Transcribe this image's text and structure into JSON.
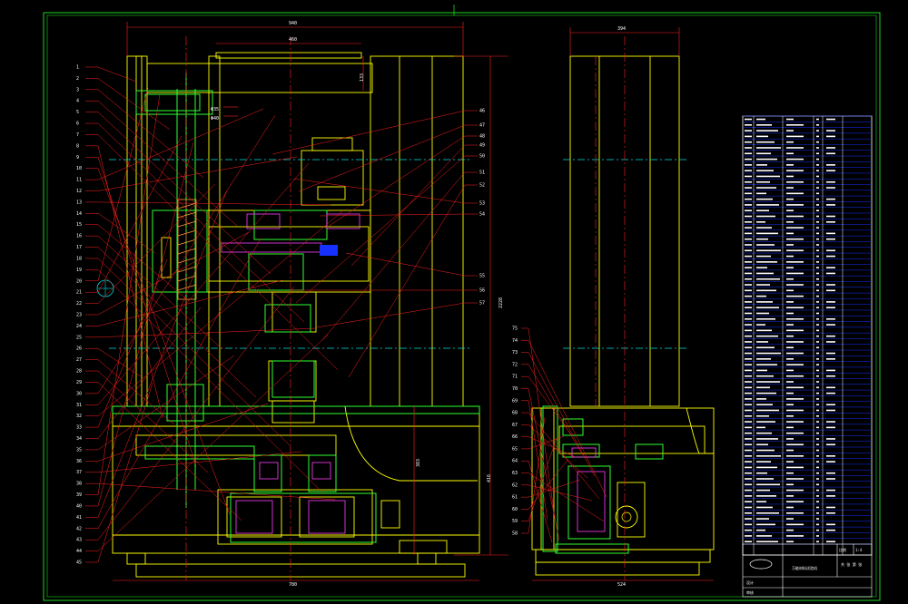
{
  "drawing": {
    "dimensions": {
      "top_overall": "940",
      "top_inner": "460",
      "right_view_top": "394",
      "vertical_total": "2228",
      "base_height": "383",
      "base_side": "416",
      "bottom_left": "780",
      "bottom_right": "524",
      "upper_right": "133",
      "bore_a": "Φ35",
      "bore_b": "Φ40"
    },
    "left_callouts": [
      "1",
      "2",
      "3",
      "4",
      "5",
      "6",
      "7",
      "8",
      "9",
      "10",
      "11",
      "12",
      "13",
      "14",
      "15",
      "16",
      "17",
      "18",
      "19",
      "20",
      "21",
      "22",
      "23",
      "24",
      "25",
      "26",
      "27",
      "28",
      "29",
      "30",
      "31",
      "32",
      "33",
      "34",
      "35",
      "36",
      "37",
      "38",
      "39",
      "40",
      "41",
      "42",
      "43",
      "44",
      "45"
    ],
    "right_callouts": [
      "46",
      "47",
      "48",
      "49",
      "50",
      "51",
      "52",
      "53",
      "54",
      "55",
      "56",
      "57"
    ],
    "side_callouts": [
      "58",
      "59",
      "60",
      "61",
      "62",
      "63",
      "64",
      "65",
      "66",
      "67",
      "68",
      "69",
      "70",
      "71",
      "72",
      "73",
      "74",
      "75"
    ],
    "title_block": {
      "title": "万能材料试验机",
      "scale_label": "比例",
      "scale": "1:4",
      "sheet_label": "共 张 第 张",
      "design": "设计",
      "check": "审核"
    },
    "colors": {
      "border": "#1fd31f",
      "yellow": "#ffff00",
      "red": "#ff2020",
      "green": "#30ff30",
      "cyan": "#00e0e0",
      "magenta": "#ff40ff",
      "blue": "#1530ff",
      "white": "#ffffff"
    }
  }
}
